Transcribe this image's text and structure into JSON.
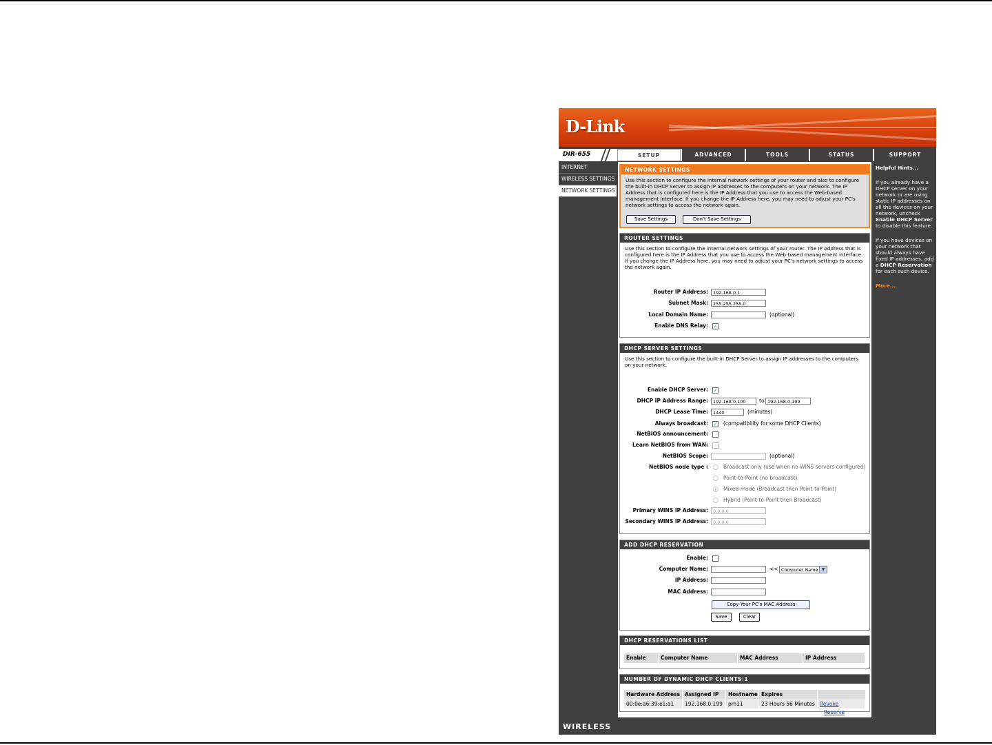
{
  "brand": {
    "logo": "D-Link",
    "model": "DIR-655",
    "footer": "WIRELESS"
  },
  "tabs": [
    "SETUP",
    "ADVANCED",
    "TOOLS",
    "STATUS",
    "SUPPORT"
  ],
  "leftnav": [
    "INTERNET",
    "WIRELESS SETTINGS",
    "NETWORK SETTINGS"
  ],
  "network": {
    "title": "NETWORK SETTINGS",
    "desc": "Use this section to configure the internal network settings of your router and also to configure the built-in DHCP Server to assign IP addresses to the computers on your network. The IP Address that is configured here is the IP Address that you use to access the Web-based management interface. If you change the IP Address here, you may need to adjust your PC's network settings to access the network again.",
    "save": "Save Settings",
    "dont_save": "Don't Save Settings"
  },
  "router": {
    "title": "ROUTER SETTINGS",
    "desc": "Use this section to configure the internal network settings of your router. The IP Address that is configured here is the IP Address that you use to access the Web-based management interface. If you change the IP Address here, you may need to adjust your PC's network settings to access the network again.",
    "ip_label": "Router IP Address:",
    "ip": "192.168.0.1",
    "mask_label": "Subnet Mask:",
    "mask": "255.255.255.0",
    "domain_label": "Local Domain Name:",
    "optional": "(optional)",
    "dns_label": "Enable DNS Relay:"
  },
  "dhcp": {
    "title": "DHCP SERVER SETTINGS",
    "desc": "Use this section to configure the built-in DHCP Server to assign IP addresses to the computers on your network.",
    "enable_label": "Enable DHCP Server:",
    "range_label": "DHCP IP Address Range:",
    "range_start": "192.168.0.100",
    "to": "to",
    "range_end": "192.168.0.199",
    "lease_label": "DHCP Lease Time:",
    "lease": "1440",
    "minutes": "(minutes)",
    "broadcast_label": "Always broadcast:",
    "broadcast_note": "(compatibility for some DHCP Clients)",
    "netbios_ann_label": "NetBIOS announcement:",
    "netbios_wan_label": "Learn NetBIOS from WAN:",
    "scope_label": "NetBIOS Scope:",
    "optional": "(optional)",
    "node_label": "NetBIOS node type :",
    "nodes": [
      "Broadcast only (use when no WINS servers configured)",
      "Point-to-Point (no broadcast)",
      "Mixed-mode (Broadcast then Point-to-Point)",
      "Hybrid (Point-to-Point then Broadcast)"
    ],
    "wins1_label": "Primary WINS IP Address:",
    "wins1": "0.0.0.0",
    "wins2_label": "Secondary WINS IP Address:",
    "wins2": "0.0.0.0"
  },
  "reservation": {
    "title": "ADD DHCP RESERVATION",
    "enable_label": "Enable:",
    "name_label": "Computer Name:",
    "arrows": "<<",
    "select": "Computer Name",
    "ip_label": "IP Address:",
    "mac_label": "MAC Address:",
    "copy": "Copy Your PC's MAC Address",
    "save": "Save",
    "clear": "Clear"
  },
  "res_list": {
    "title": "DHCP RESERVATIONS LIST",
    "cols": [
      "Enable",
      "Computer Name",
      "MAC Address",
      "IP Address"
    ]
  },
  "clients": {
    "title": "NUMBER OF DYNAMIC DHCP CLIENTS:1",
    "cols": [
      "Hardware Address",
      "Assigned IP",
      "Hostname",
      "Expires"
    ],
    "row": {
      "hw": "00:0e:a6:39:e1:a1",
      "ip": "192.168.0.199",
      "host": "pm11",
      "expires": "23 Hours 56 Minutes",
      "revoke": "Revoke",
      "reserve": "Reserve"
    }
  },
  "hints": {
    "title": "Helpful Hints...",
    "p1_a": "If you already have a DHCP server on your network or are using static IP addresses on all the devices on your network, uncheck ",
    "p1_b": "Enable DHCP Server",
    "p1_c": " to disable this feature.",
    "p2_a": "If you have devices on your network that should always have fixed IP addresses, add a ",
    "p2_b": "DHCP Reservation",
    "p2_c": " for each such device.",
    "more": "More..."
  }
}
